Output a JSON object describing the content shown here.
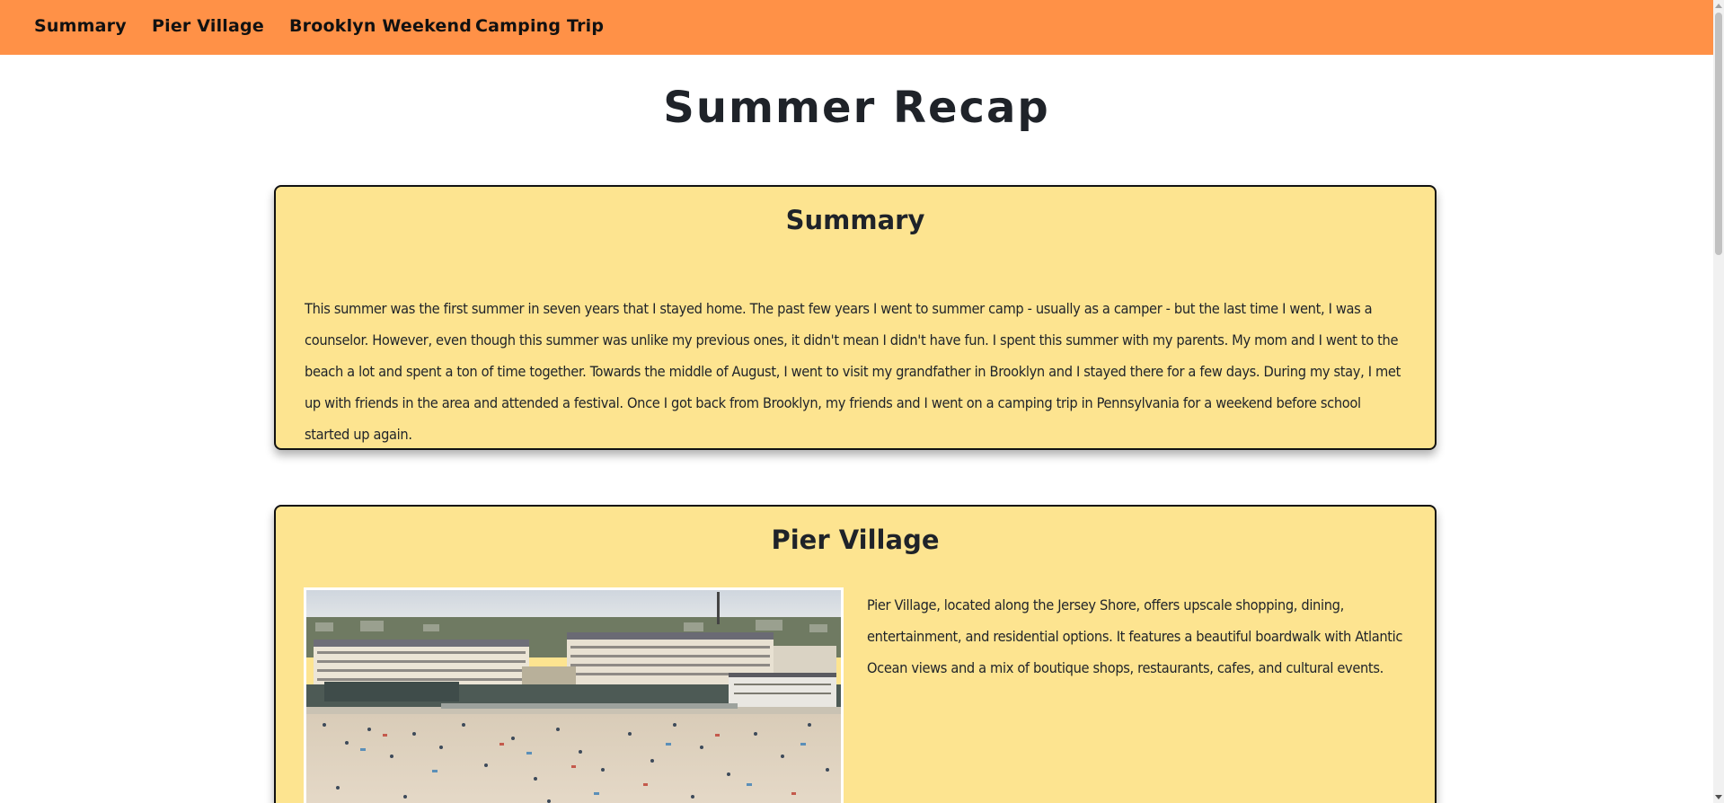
{
  "nav": {
    "items": [
      {
        "label": "Summary"
      },
      {
        "label": "Pier Village"
      },
      {
        "label": "Brooklyn Weekend"
      },
      {
        "label": "Camping Trip"
      }
    ]
  },
  "page": {
    "title": "Summer Recap"
  },
  "sections": {
    "summary": {
      "heading": "Summary",
      "text": "This summer was the first summer in seven years that I stayed home. The past few years I went to summer camp - usually as a camper - but the last time I went, I was a counselor. However, even though this summer was unlike my previous ones, it didn't mean I didn't have fun. I spent this summer with my parents. My mom and I went to the beach a lot and spent a ton of time together. Towards the middle of August, I went to visit my grandfather in Brooklyn and I stayed there for a few days. During my stay, I met up with friends in the area and attended a festival. Once I got back from Brooklyn, my friends and I went on a camping trip in Pennsylvania for a weekend before school started up again."
    },
    "pier_village": {
      "heading": "Pier Village",
      "text": "Pier Village, located along the Jersey Shore, offers upscale shopping, dining, entertainment, and residential options. It features a beautiful boardwalk with Atlantic Ocean views and a mix of boutique shops, restaurants, cafes, and cultural events."
    }
  },
  "colors": {
    "navbar": "#ff9147",
    "card_background": "#fde490",
    "card_border": "#111111",
    "text": "#1f2329"
  }
}
